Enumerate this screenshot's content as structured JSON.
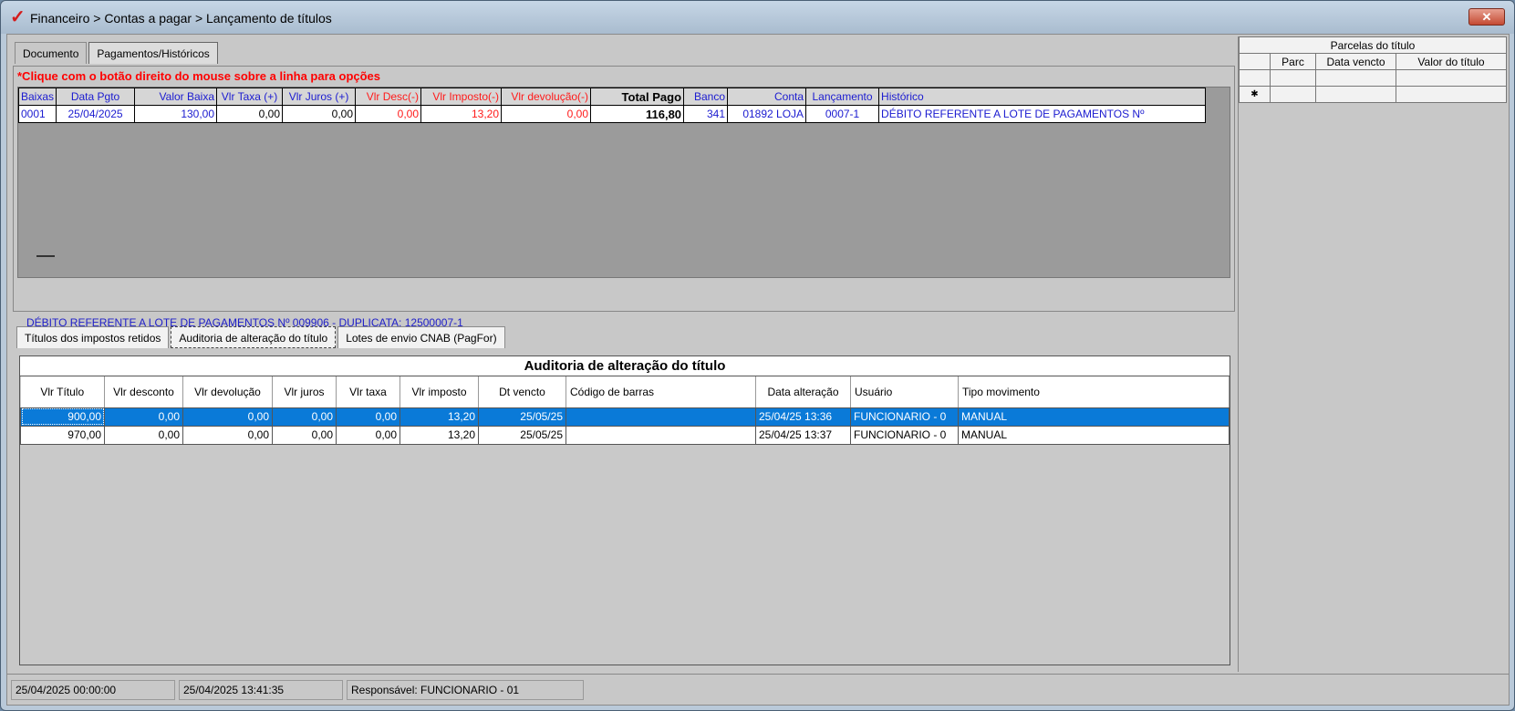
{
  "window": {
    "title": "Financeiro > Contas a pagar > Lançamento de títulos",
    "close_label": "✕"
  },
  "tabs_top": [
    "Documento",
    "Pagamentos/Históricos"
  ],
  "hint": "*Clique com o botão direito do mouse sobre a linha para opções",
  "payments": {
    "columns": [
      "Baixas",
      "Data Pgto",
      "Valor Baixa",
      "Vlr Taxa (+)",
      "Vlr Juros (+)",
      "Vlr Desc(-)",
      "Vlr Imposto(-)",
      "Vlr devolução(-)",
      "Total Pago",
      "Banco",
      "Conta",
      "Lançamento",
      "Histórico"
    ],
    "rows": [
      [
        "0001",
        "25/04/2025",
        "130,00",
        "0,00",
        "0,00",
        "0,00",
        "13,20",
        "0,00",
        "116,80",
        "341",
        "01892 LOJA",
        "0007-1",
        "DÉBITO REFERENTE A LOTE DE PAGAMENTOS Nº"
      ]
    ]
  },
  "history_text": "DÉBITO REFERENTE A LOTE DE PAGAMENTOS Nº 009906 - DUPLICATA: 12500007-1",
  "tabs_mid": [
    "Títulos dos impostos retidos",
    "Auditoria de alteração do título",
    "Lotes de envio CNAB (PagFor)"
  ],
  "audit": {
    "title": "Auditoria de alteração do título",
    "columns": [
      "Vlr Título",
      "Vlr desconto",
      "Vlr devolução",
      "Vlr juros",
      "Vlr taxa",
      "Vlr imposto",
      "Dt vencto",
      "Código de barras",
      "Data alteração",
      "Usuário",
      "Tipo  movimento"
    ],
    "rows": [
      [
        "900,00",
        "0,00",
        "0,00",
        "0,00",
        "0,00",
        "13,20",
        "25/05/25",
        "",
        "25/04/25 13:36",
        "FUNCIONARIO - 0",
        "MANUAL"
      ],
      [
        "970,00",
        "0,00",
        "0,00",
        "0,00",
        "0,00",
        "13,20",
        "25/05/25",
        "",
        "25/04/25 13:37",
        "FUNCIONARIO - 0",
        "MANUAL"
      ]
    ]
  },
  "parcelas": {
    "title": "Parcelas do título",
    "columns": [
      "Parc",
      "Data vencto",
      "Valor do título"
    ],
    "indicator": "✱"
  },
  "status": [
    "25/04/2025 00:00:00",
    "25/04/2025 13:41:35",
    "Responsável: FUNCIONARIO - 01"
  ]
}
